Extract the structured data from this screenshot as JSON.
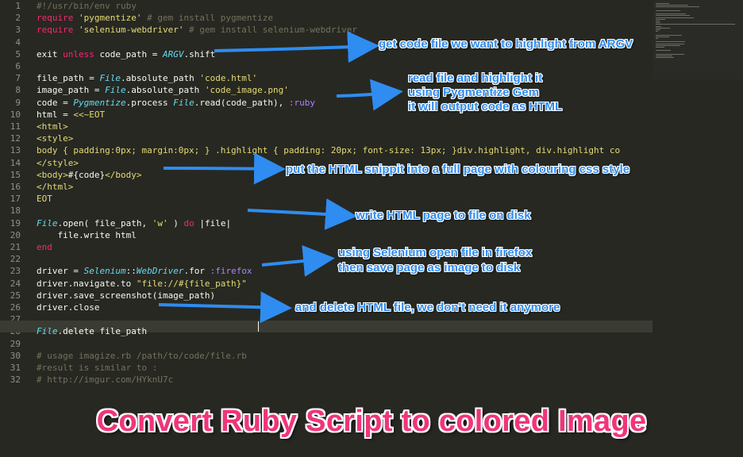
{
  "editor": {
    "lines": [
      {
        "n": "1",
        "tokens": [
          {
            "t": "cm",
            "v": "#!/usr/bin/env ruby"
          }
        ]
      },
      {
        "n": "2",
        "tokens": [
          {
            "t": "kw",
            "v": "require "
          },
          {
            "t": "str",
            "v": "'pygmentize'"
          },
          {
            "t": "cm",
            "v": " # gem install pygmentize"
          }
        ]
      },
      {
        "n": "3",
        "tokens": [
          {
            "t": "kw",
            "v": "require "
          },
          {
            "t": "str",
            "v": "'selenium-webdriver'"
          },
          {
            "t": "cm",
            "v": " # gem install selenium-webdriver"
          }
        ]
      },
      {
        "n": "4",
        "tokens": []
      },
      {
        "n": "5",
        "tokens": [
          {
            "t": "plain",
            "v": "exit "
          },
          {
            "t": "kw",
            "v": "unless"
          },
          {
            "t": "plain",
            "v": " code_path = "
          },
          {
            "t": "cls",
            "v": "ARGV"
          },
          {
            "t": "plain",
            "v": ".shift"
          }
        ]
      },
      {
        "n": "6",
        "tokens": []
      },
      {
        "n": "7",
        "tokens": [
          {
            "t": "plain",
            "v": "file_path = "
          },
          {
            "t": "cls",
            "v": "File"
          },
          {
            "t": "plain",
            "v": ".absolute_path "
          },
          {
            "t": "str",
            "v": "'code.html'"
          }
        ]
      },
      {
        "n": "8",
        "tokens": [
          {
            "t": "plain",
            "v": "image_path = "
          },
          {
            "t": "cls",
            "v": "File"
          },
          {
            "t": "plain",
            "v": ".absolute_path "
          },
          {
            "t": "str",
            "v": "'code_image.png'"
          }
        ]
      },
      {
        "n": "9",
        "tokens": [
          {
            "t": "plain",
            "v": "code = "
          },
          {
            "t": "cls",
            "v": "Pygmentize"
          },
          {
            "t": "plain",
            "v": ".process "
          },
          {
            "t": "cls",
            "v": "File"
          },
          {
            "t": "plain",
            "v": ".read(code_path), "
          },
          {
            "t": "sym",
            "v": ":ruby"
          }
        ]
      },
      {
        "n": "10",
        "tokens": [
          {
            "t": "plain",
            "v": "html = "
          },
          {
            "t": "str",
            "v": "<<~EOT"
          }
        ]
      },
      {
        "n": "11",
        "tokens": [
          {
            "t": "str",
            "v": "<html>"
          }
        ]
      },
      {
        "n": "12",
        "tokens": [
          {
            "t": "str",
            "v": "<style>"
          }
        ]
      },
      {
        "n": "13",
        "tokens": [
          {
            "t": "str",
            "v": "body { padding:0px; margin:0px; } .highlight { padding: 20px; font-size: 13px; }div.highlight, div.highlight co"
          }
        ]
      },
      {
        "n": "14",
        "tokens": [
          {
            "t": "str",
            "v": "</style>"
          }
        ]
      },
      {
        "n": "15",
        "tokens": [
          {
            "t": "str",
            "v": "<body>"
          },
          {
            "t": "plain",
            "v": "#{code}"
          },
          {
            "t": "str",
            "v": "</body>"
          }
        ]
      },
      {
        "n": "16",
        "tokens": [
          {
            "t": "str",
            "v": "</html>"
          }
        ]
      },
      {
        "n": "17",
        "tokens": [
          {
            "t": "str",
            "v": "EOT"
          }
        ]
      },
      {
        "n": "18",
        "tokens": []
      },
      {
        "n": "19",
        "tokens": [
          {
            "t": "cls",
            "v": "File"
          },
          {
            "t": "plain",
            "v": ".open( file_path, "
          },
          {
            "t": "str",
            "v": "'w'"
          },
          {
            "t": "plain",
            "v": " ) "
          },
          {
            "t": "kw",
            "v": "do"
          },
          {
            "t": "plain",
            "v": " |file|"
          }
        ]
      },
      {
        "n": "20",
        "tokens": [
          {
            "t": "plain",
            "v": "    file.write html"
          }
        ]
      },
      {
        "n": "21",
        "tokens": [
          {
            "t": "kw",
            "v": "end"
          }
        ]
      },
      {
        "n": "22",
        "tokens": []
      },
      {
        "n": "23",
        "tokens": [
          {
            "t": "plain",
            "v": "driver = "
          },
          {
            "t": "cls",
            "v": "Selenium"
          },
          {
            "t": "plain",
            "v": "::"
          },
          {
            "t": "cls",
            "v": "WebDriver"
          },
          {
            "t": "plain",
            "v": ".for "
          },
          {
            "t": "sym",
            "v": ":firefox"
          }
        ]
      },
      {
        "n": "24",
        "tokens": [
          {
            "t": "plain",
            "v": "driver.navigate.to "
          },
          {
            "t": "str",
            "v": "\"file://#{file_path}\""
          }
        ]
      },
      {
        "n": "25",
        "tokens": [
          {
            "t": "plain",
            "v": "driver.save_screenshot(image_path)"
          }
        ]
      },
      {
        "n": "26",
        "tokens": [
          {
            "t": "plain",
            "v": "driver.close"
          }
        ]
      },
      {
        "n": "27",
        "tokens": []
      },
      {
        "n": "28",
        "tokens": [
          {
            "t": "cls",
            "v": "File"
          },
          {
            "t": "plain",
            "v": ".delete file_path"
          }
        ]
      },
      {
        "n": "29",
        "tokens": []
      },
      {
        "n": "30",
        "tokens": [
          {
            "t": "cm",
            "v": "# usage imagize.rb /path/to/code/file.rb"
          }
        ]
      },
      {
        "n": "31",
        "tokens": [
          {
            "t": "cm",
            "v": "#result is similar to :"
          }
        ]
      },
      {
        "n": "32",
        "tokens": [
          {
            "t": "cm",
            "v": "# http://imgur.com/HYknU7c"
          }
        ]
      }
    ]
  },
  "annotations": [
    {
      "text": "get code file we want to highlight from ARGV"
    },
    {
      "text": "read file and highlight it"
    },
    {
      "text": "using Pygmentize Gem"
    },
    {
      "text": "it will output code as HTML"
    },
    {
      "text": "put the HTML snippit into a full page with colouring css style"
    },
    {
      "text": "write HTML page to file on disk"
    },
    {
      "text": "using Selenium open file in firefox"
    },
    {
      "text": "then save page as image to disk"
    },
    {
      "text": "and delete HTML file, we don't need it anymore"
    }
  ],
  "caption": "Convert Ruby Script to colored Image",
  "colors": {
    "background": "#272822",
    "keyword": "#f92672",
    "string": "#e6db74",
    "comment": "#75715e",
    "class": "#66d9ef",
    "symbol": "#ae81ff",
    "annotation": "#2f8cf0",
    "caption": "#f0357a"
  }
}
